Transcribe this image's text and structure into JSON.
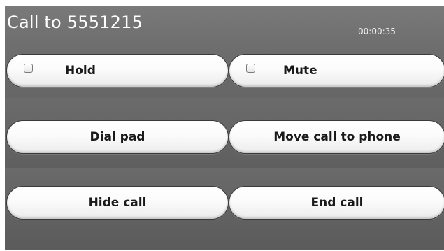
{
  "header": {
    "title": "Call to 5551215",
    "timer": "00:00:35"
  },
  "buttons": {
    "hold": {
      "label": "Hold",
      "checked": false
    },
    "mute": {
      "label": "Mute",
      "checked": false
    },
    "dial_pad": {
      "label": "Dial pad"
    },
    "move_call": {
      "label": "Move call to phone"
    },
    "hide_call": {
      "label": "Hide call"
    },
    "end_call": {
      "label": "End call"
    }
  },
  "colors": {
    "background": "#6e6e6e",
    "button_face": "#ffffff",
    "title_text": "#ffffff"
  }
}
